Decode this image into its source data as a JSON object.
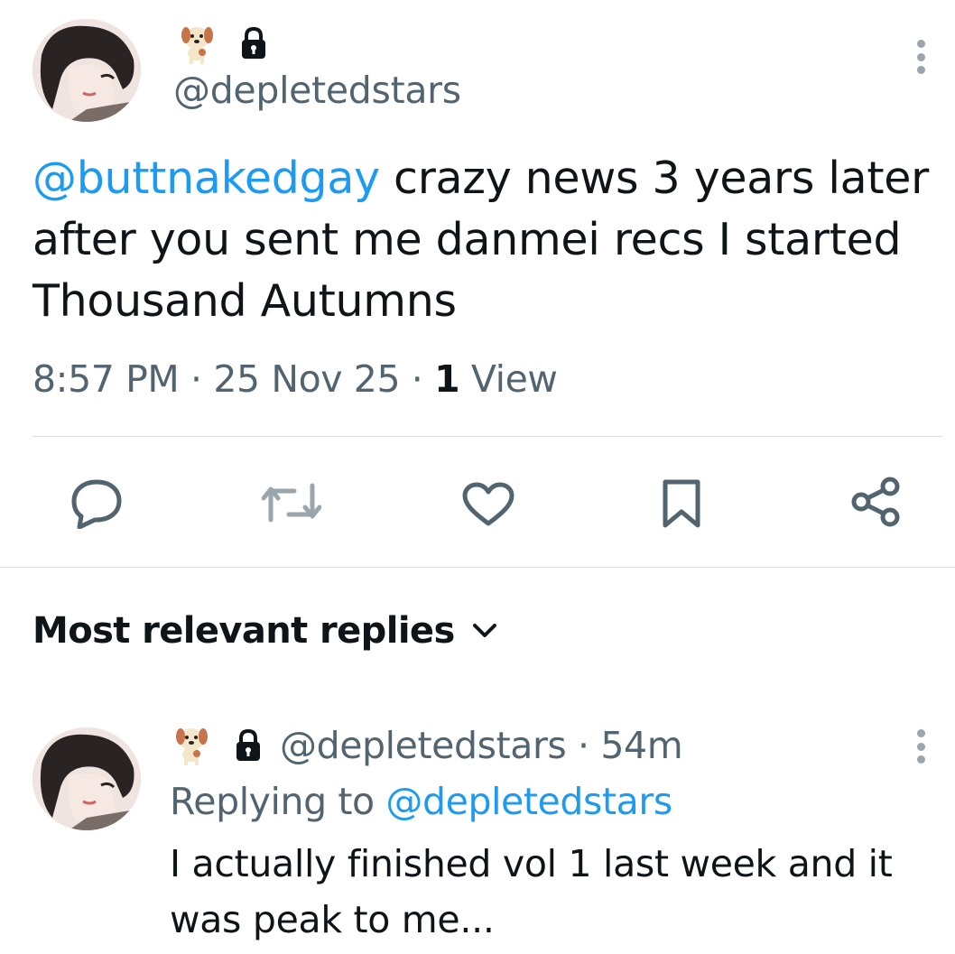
{
  "tweet": {
    "author_handle": "@depletedstars",
    "mention": "@buttnakedgay",
    "text_after_mention": " crazy news 3 years later after you sent me danmei recs I started Thousand Autumns",
    "time": "8:57 PM",
    "date": "25 Nov 25",
    "view_count": "1",
    "view_label": "View",
    "separator": "·"
  },
  "actions": {
    "reply_icon": "speech-bubble-icon",
    "retweet_icon": "retweet-icon",
    "like_icon": "heart-icon",
    "bookmark_icon": "bookmark-icon",
    "share_icon": "share-icon"
  },
  "replies": {
    "sort_label": "Most relevant replies",
    "items": [
      {
        "handle": "@depletedstars",
        "time_ago": "54m",
        "separator": "·",
        "replying_prefix": "Replying to",
        "replying_handle": "@depletedstars",
        "text": "I actually finished vol 1 last week and it was peak to me..."
      }
    ]
  },
  "colors": {
    "link_blue": "#1d9bf0",
    "secondary_gray": "#536471",
    "icon_gray": "#536471",
    "divider": "#dfe3e6"
  }
}
